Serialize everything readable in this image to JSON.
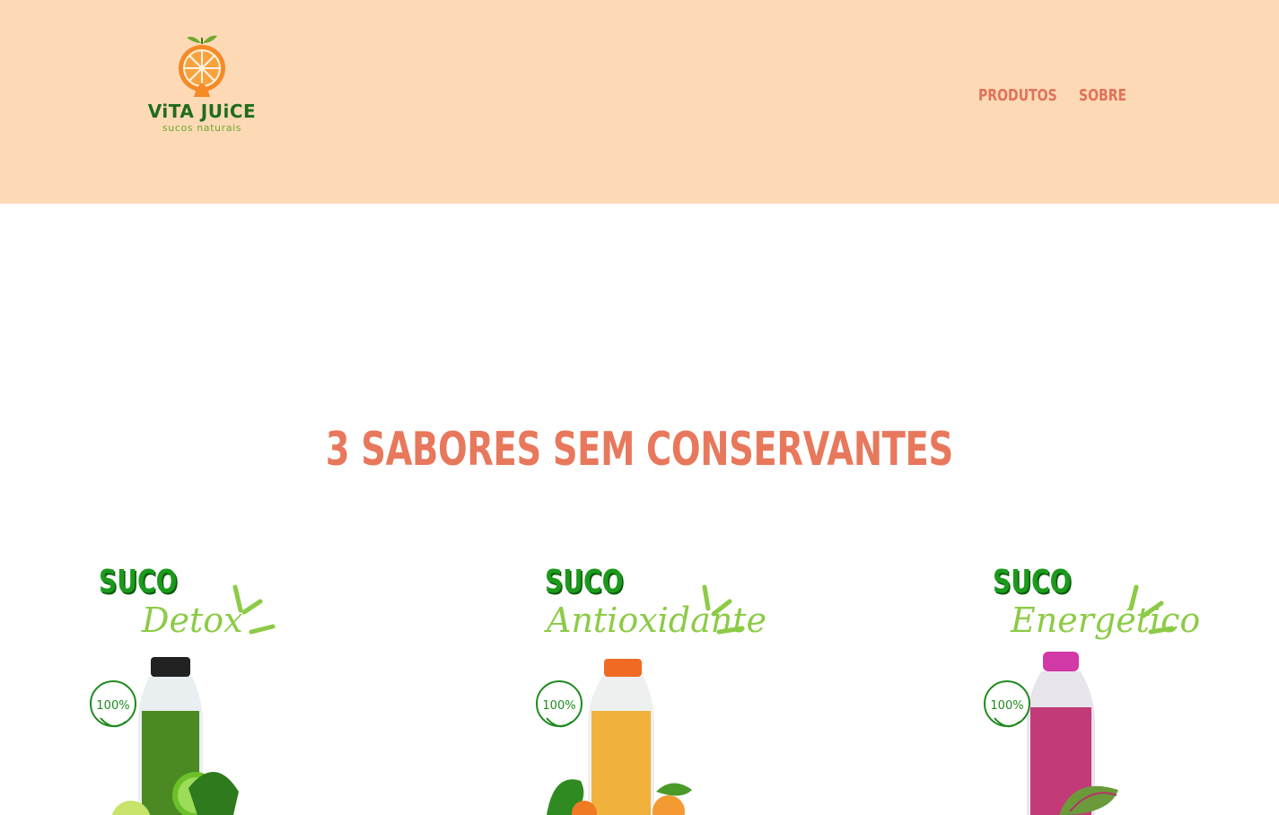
{
  "brand": {
    "name": "ViTA JUiCE",
    "tagline": "sucos naturais"
  },
  "nav": {
    "items": [
      "PRODUTOS",
      "SOBRE"
    ]
  },
  "section": {
    "title": "3 SABORES SEM CONSERVANTES"
  },
  "products": [
    {
      "label": "SUCO",
      "flavor": "Detox",
      "badge": "100%",
      "juice_color": "#4b8a22",
      "cap_color": "#222222"
    },
    {
      "label": "SUCO",
      "flavor": "Antioxidante",
      "badge": "100%",
      "juice_color": "#f0b23c",
      "cap_color": "#f06a24"
    },
    {
      "label": "SUCO",
      "flavor": "Energético",
      "badge": "100%",
      "juice_color": "#c23a78",
      "cap_color": "#d238a6"
    }
  ],
  "colors": {
    "header_bg": "#fdd9b6",
    "accent": "#e8785c",
    "brand_green": "#1f6d1b"
  }
}
